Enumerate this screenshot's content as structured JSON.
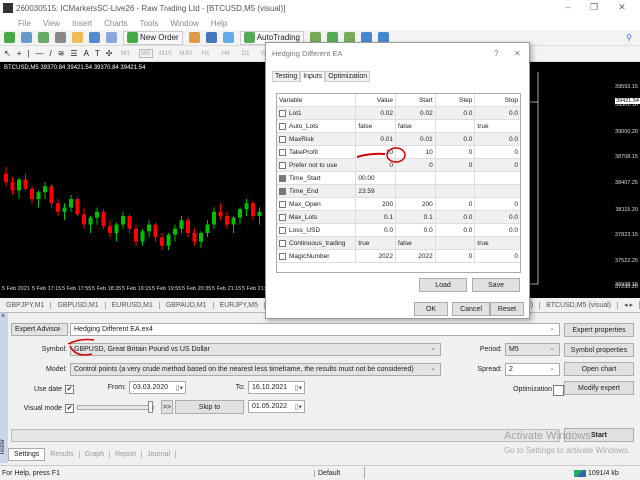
{
  "window": {
    "title": "260030515: ICMarketsSC-Live26 - Raw Trading Ltd - [BTCUSD,M5 (visual)]",
    "minimize": "–",
    "restore": "❐",
    "close": "✕"
  },
  "menu": [
    "File",
    "View",
    "Insert",
    "Charts",
    "Tools",
    "Window",
    "Help"
  ],
  "toolbar": {
    "new_order": "New Order",
    "auto_trading": "AutoTrading",
    "timeframes": [
      "M1",
      "M5",
      "M15",
      "M30",
      "H1",
      "H4",
      "D1",
      "W1",
      "MN"
    ]
  },
  "chart": {
    "header": "BTCUSD,M5  39370.84 39421.54 39370.84 39421.54",
    "current_price": "39421.54",
    "price_labels": [
      "39593.15",
      "39301.10",
      "39000.20",
      "38708.15",
      "38407.25",
      "38115.20",
      "37823.15",
      "37522.25",
      "37230.20",
      "36938.15"
    ],
    "time_labels": [
      "5 Feb 2021",
      "5 Feb 17:15",
      "5 Feb 17:55",
      "5 Feb 18:35",
      "5 Feb 19:15",
      "5 Feb 19:55",
      "5 Feb 20:35",
      "5 Feb 21:15",
      "5 Feb 21:55"
    ],
    "bull_color": "#00c000",
    "bear_color": "#ff0000",
    "candles": [
      [
        38300,
        38380,
        38150,
        38200
      ],
      [
        38200,
        38260,
        38050,
        38100
      ],
      [
        38100,
        38250,
        38000,
        38230
      ],
      [
        38230,
        38300,
        38100,
        38120
      ],
      [
        38120,
        38150,
        37950,
        38000
      ],
      [
        38000,
        38100,
        37900,
        38080
      ],
      [
        38080,
        38200,
        38000,
        38150
      ],
      [
        38150,
        38180,
        37900,
        37950
      ],
      [
        37950,
        38000,
        37800,
        37850
      ],
      [
        37850,
        37950,
        37750,
        37900
      ],
      [
        37900,
        38050,
        37850,
        38000
      ],
      [
        38000,
        38020,
        37800,
        37820
      ],
      [
        37820,
        37900,
        37650,
        37700
      ],
      [
        37700,
        37800,
        37600,
        37780
      ],
      [
        37780,
        37900,
        37700,
        37850
      ],
      [
        37850,
        37880,
        37650,
        37680
      ],
      [
        37680,
        37750,
        37550,
        37600
      ],
      [
        37600,
        37720,
        37500,
        37700
      ],
      [
        37700,
        37850,
        37650,
        37800
      ],
      [
        37800,
        37820,
        37600,
        37650
      ],
      [
        37650,
        37700,
        37450,
        37500
      ],
      [
        37500,
        37650,
        37450,
        37620
      ],
      [
        37620,
        37750,
        37550,
        37700
      ],
      [
        37700,
        37720,
        37500,
        37550
      ],
      [
        37550,
        37600,
        37400,
        37450
      ],
      [
        37450,
        37600,
        37400,
        37580
      ],
      [
        37580,
        37700,
        37500,
        37650
      ],
      [
        37650,
        37800,
        37600,
        37750
      ],
      [
        37750,
        37780,
        37550,
        37600
      ],
      [
        37600,
        37650,
        37450,
        37500
      ],
      [
        37500,
        37620,
        37420,
        37600
      ],
      [
        37600,
        37750,
        37550,
        37700
      ],
      [
        37700,
        37900,
        37650,
        37850
      ],
      [
        37850,
        37950,
        37750,
        37800
      ],
      [
        37800,
        37850,
        37650,
        37700
      ],
      [
        37700,
        37800,
        37600,
        37780
      ],
      [
        37780,
        37900,
        37700,
        37880
      ],
      [
        37880,
        38000,
        37800,
        37950
      ],
      [
        37950,
        37980,
        37750,
        37800
      ],
      [
        37800,
        37900,
        37700,
        37850
      ]
    ]
  },
  "chart_tabs": [
    "GBPJPY,M1",
    "GBPUSD,M1",
    "EURUSD,M1",
    "GBPAUD,M1",
    "EURJPY,M5",
    "EURJPY,H1",
    "EURJPY,M",
    "USD,M5 (visual)",
    "BTCUSD,M5 (visual)"
  ],
  "dialog": {
    "title": "Hedging Different EA",
    "help": "?",
    "close": "✕",
    "tabs": [
      "Testing",
      "Inputs",
      "Optimization"
    ],
    "columns": [
      "Variable",
      "Value",
      "Start",
      "Step",
      "Stop"
    ],
    "rows": [
      {
        "name": "Lot1",
        "value": "0.02",
        "start": "0.02",
        "step": "0.0",
        "stop": "0.0"
      },
      {
        "name": "Auto_Lots",
        "value": "false",
        "start": "false",
        "step": "",
        "stop": "true"
      },
      {
        "name": "MaxRisk",
        "value": "0.01",
        "start": "0.01",
        "step": "0.0",
        "stop": "0.0"
      },
      {
        "name": "TakeProfit",
        "value": "10",
        "start": "10",
        "step": "0",
        "stop": "0"
      },
      {
        "name": "Prefer not to use",
        "value": "0",
        "start": "0",
        "step": "0",
        "stop": "0"
      },
      {
        "name": "Time_Start",
        "value": "00:00",
        "start": "",
        "step": "",
        "stop": ""
      },
      {
        "name": "Time_End",
        "value": "23:59",
        "start": "",
        "step": "",
        "stop": ""
      },
      {
        "name": "Max_Open",
        "value": "200",
        "start": "200",
        "step": "0",
        "stop": "0"
      },
      {
        "name": "Max_Lots",
        "value": "0.1",
        "start": "0.1",
        "step": "0.0",
        "stop": "0.0"
      },
      {
        "name": "Loss_USD",
        "value": "0.0",
        "start": "0.0",
        "step": "0.0",
        "stop": "0.0"
      },
      {
        "name": "Continuous_trading",
        "value": "true",
        "start": "false",
        "step": "",
        "stop": "true"
      },
      {
        "name": "MagicNumber",
        "value": "2022",
        "start": "2022",
        "step": "0",
        "stop": "0"
      }
    ],
    "load": "Load",
    "save": "Save",
    "ok": "OK",
    "cancel": "Cancel",
    "reset": "Reset"
  },
  "tester": {
    "type": "Expert Advisor",
    "ea": "Hedging Different EA.ex4",
    "symbol_label": "Symbol:",
    "symbol": "GBPUSD, Great Britain Pound vs US Dollar",
    "model_label": "Model:",
    "model": "Control points (a very crude method based on the nearest less timeframe, the results must not be considered)",
    "period_label": "Period:",
    "period": "M5",
    "spread_label": "Spread:",
    "spread": "2",
    "optimization_label": "Optimization",
    "use_date_label": "Use date",
    "use_date": true,
    "from_label": "From:",
    "from": "03.03.2020",
    "to_label": "To:",
    "to": "16.10.2021",
    "visual_mode_label": "Visual mode",
    "visual_mode": true,
    "ff": ">>",
    "skip_to": "Skip to",
    "skip_date": "01.05.2022",
    "buttons": {
      "expert_properties": "Expert properties",
      "symbol_properties": "Symbol properties",
      "open_chart": "Open chart",
      "modify_expert": "Modify expert",
      "start": "Start"
    },
    "tabs": [
      "Settings",
      "Results",
      "Graph",
      "Report",
      "Journal"
    ],
    "side_label": "Tester"
  },
  "watermark": {
    "line1": "Activate Windows",
    "line2": "Go to Settings to activate Windows."
  },
  "status": {
    "help": "For Help, press F1",
    "profile": "Default",
    "traffic": "1091/4 kb"
  },
  "annotation_color": "#d00000"
}
